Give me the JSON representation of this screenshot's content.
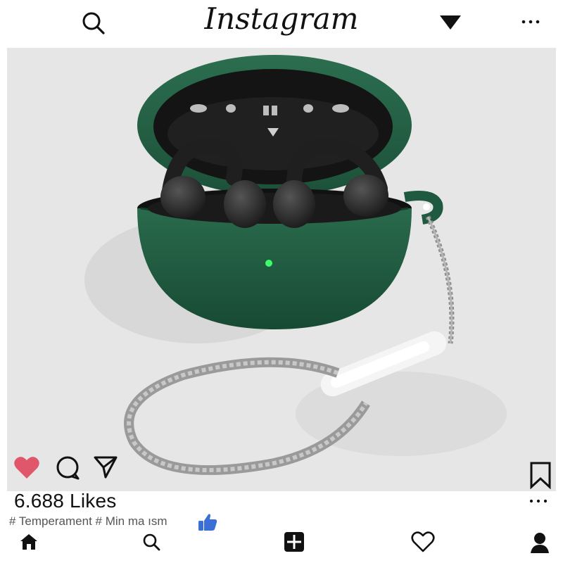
{
  "header": {
    "brand": "Instagram",
    "icons": [
      "search-icon",
      "dropdown-triangle-icon",
      "more-dots-icon"
    ]
  },
  "post": {
    "image_alt": "Green earbuds charging case with lanyard",
    "actions": [
      "heart-filled-icon",
      "comment-icon",
      "share-icon",
      "bookmark-icon"
    ],
    "likes": "6.688 Likes",
    "hashtags": "# Temperament # Min ma ısm",
    "liked": true
  },
  "bottom_nav": {
    "items": [
      "home-icon",
      "search-icon",
      "new-post-icon",
      "activity-heart-icon",
      "profile-icon"
    ]
  },
  "colors": {
    "heart": "#e0566a",
    "case_green": "#1f5a40",
    "thumb_blue": "#3b6fd6",
    "photo_bg": "#e6e6e6"
  }
}
